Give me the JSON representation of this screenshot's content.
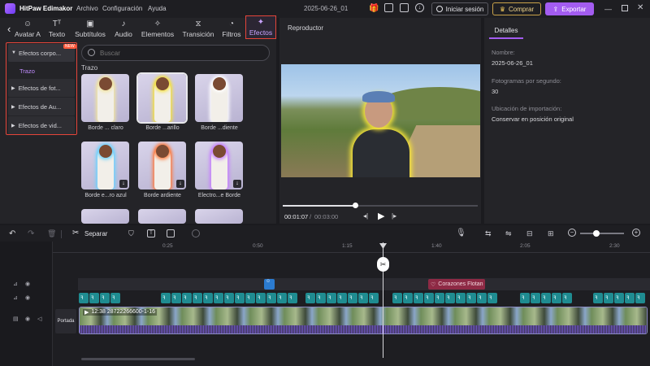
{
  "app": {
    "title": "HitPaw Edimakor",
    "project_name": "2025-06-26_01"
  },
  "menu": [
    "Archivo",
    "Configuración",
    "Ayuda"
  ],
  "header_buttons": {
    "login": "Iniciar sesión",
    "buy": "Comprar",
    "export": "Exportar"
  },
  "tabs": [
    {
      "label": "Avatar AI",
      "icon": "avatar-icon"
    },
    {
      "label": "Texto",
      "icon": "text-icon"
    },
    {
      "label": "Subtítulos",
      "icon": "subtitle-icon"
    },
    {
      "label": "Audio",
      "icon": "music-icon"
    },
    {
      "label": "Elementos",
      "icon": "elements-icon"
    },
    {
      "label": "Transición",
      "icon": "transition-icon"
    },
    {
      "label": "Filtros",
      "icon": "filter-icon"
    },
    {
      "label": "Efectos",
      "icon": "magic-wand-icon",
      "active": true
    }
  ],
  "categories": {
    "items": [
      "Efectos corpo...",
      "Efectos de fot...",
      "Efectos de Au...",
      "Efectos de vid..."
    ],
    "sub_item": "Trazo",
    "new_badge": "NEW"
  },
  "search": {
    "placeholder": "Buscar"
  },
  "section_title": "Trazo",
  "effects": [
    {
      "label": "Borde ... claro",
      "glow": "#f3e6a0"
    },
    {
      "label": "Borde ...arillo",
      "glow": "#f6e23a",
      "selected": true
    },
    {
      "label": "Borde ...diente",
      "glow": "#ffffff"
    },
    {
      "label": "Borde e...ro azul",
      "glow": "#6ad3ff",
      "download": true
    },
    {
      "label": "Borde ardiente",
      "glow": "#ff7a3c",
      "download": true
    },
    {
      "label": "Electro...e Borde",
      "glow": "#c77dff",
      "download": true
    }
  ],
  "player": {
    "title": "Reproductor",
    "time_current": "00:01:07",
    "time_total": "00:03:00",
    "progress": 0.37
  },
  "details": {
    "tab": "Detalles",
    "fields": [
      {
        "label": "Nombre:",
        "value": "2025-06-26_01"
      },
      {
        "label": "Fotogramas por segundo:",
        "value": "30"
      },
      {
        "label": "Ubicación de importación:",
        "value": "Conservar en posición original"
      }
    ]
  },
  "timeline_toolbar": {
    "split_label": "Separar"
  },
  "ruler": [
    "0:25",
    "0:50",
    "1:15",
    "1:40",
    "2:05",
    "2:30"
  ],
  "tracks": {
    "sticker_clip": "Corazones Flotan",
    "video_clip": "12:38 28722266600-1-16",
    "cover_label": "Portada"
  },
  "fx_clip_count": 27,
  "colors": {
    "accent": "#a35cf0",
    "highlight_border": "#e5453a",
    "fx_clip": "#1f8c91",
    "sticker_clip": "#8e2a45",
    "video_clip": "#3a3550"
  }
}
